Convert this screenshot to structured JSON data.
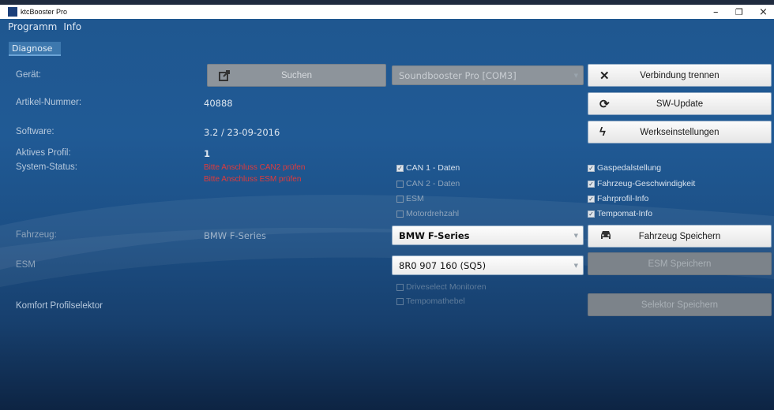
{
  "window": {
    "title": "ktcBooster Pro",
    "minimize": "–",
    "maximize": "❐",
    "close": "×"
  },
  "menu": [
    "Programm",
    "Info"
  ],
  "tabs": [
    "Diagnose"
  ],
  "labels": {
    "device": "Gerät:",
    "article": "Artikel-Nummer:",
    "software": "Software:",
    "profile": "Aktives Profil:",
    "status": "System-Status:",
    "vehicle": "Fahrzeug:",
    "esm": "ESM",
    "comfort": "Komfort Profilselektor"
  },
  "values": {
    "article": "40888",
    "software": "3.2 / 23-09-2016",
    "profile": "1",
    "vehicle": "BMW F-Series"
  },
  "errors": [
    "Bitte Anschluss CAN2 prüfen",
    "Bitte Anschluss ESM prüfen"
  ],
  "search_button": "Suchen",
  "device_select": "Soundbooster Pro [COM3]",
  "vehicle_select": "BMW F-Series",
  "esm_select": "8R0 907 160 (SQ5)",
  "status_checks": [
    {
      "label": "CAN 1 - Daten",
      "checked": true
    },
    {
      "label": "CAN 2 - Daten",
      "checked": false
    },
    {
      "label": "ESM",
      "checked": false
    },
    {
      "label": "Motordrehzahl",
      "checked": false
    }
  ],
  "status_checks_right": [
    {
      "label": "Gaspedalstellung",
      "checked": true
    },
    {
      "label": "Fahrzeug-Geschwindigkeit",
      "checked": true
    },
    {
      "label": "Fahrprofil-Info",
      "checked": true
    },
    {
      "label": "Tempomat-Info",
      "checked": true
    }
  ],
  "comfort_checks": [
    "Driveselect Monitoren",
    "Tempomathebel"
  ],
  "buttons": {
    "disconnect": "Verbindung trennen",
    "sw_update": "SW-Update",
    "factory": "Werkseinstellungen",
    "save_vehicle": "Fahrzeug Speichern",
    "save_esm": "ESM Speichern",
    "save_selector": "Selektor Speichern"
  },
  "icons": {
    "disconnect": "close-icon",
    "sw_update": "refresh-icon",
    "factory": "lightning-icon",
    "save_vehicle": "car-icon",
    "search": "share-icon"
  },
  "colors": {
    "accent": "#1f5790",
    "error": "#e23a3a"
  }
}
